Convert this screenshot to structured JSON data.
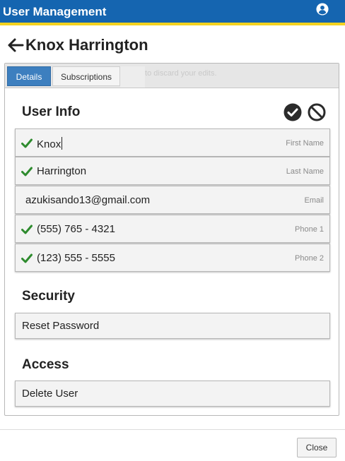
{
  "app": {
    "title": "User Management"
  },
  "header": {
    "title": "Knox Harrington"
  },
  "tabs": [
    {
      "label": "Details",
      "active": true
    },
    {
      "label": "Subscriptions",
      "active": false
    }
  ],
  "hint_text": "Press cancel to discard your edits.",
  "user_info": {
    "title": "User Info",
    "fields": [
      {
        "value": "Knox",
        "caption": "First Name",
        "validated": true
      },
      {
        "value": "Harrington",
        "caption": "Last Name",
        "validated": true
      },
      {
        "value": "azukisando13@gmail.com",
        "caption": "Email",
        "validated": false
      },
      {
        "value": "(555) 765 - 4321",
        "caption": "Phone 1",
        "validated": true
      },
      {
        "value": "(123) 555 - 5555",
        "caption": "Phone 2",
        "validated": true
      }
    ]
  },
  "security": {
    "title": "Security",
    "reset_password_label": "Reset Password"
  },
  "access": {
    "title": "Access",
    "delete_user_label": "Delete User"
  },
  "footer": {
    "close_label": "Close"
  },
  "colors": {
    "topbar": "#1565b0",
    "accent_stripe": "#f4d21f",
    "check": "#2e8b2e",
    "tab_active": "#3d7fbf"
  },
  "icons": [
    "user-circle-icon",
    "back-arrow-icon",
    "checkmark-circle-icon",
    "ban-icon",
    "check-icon"
  ]
}
